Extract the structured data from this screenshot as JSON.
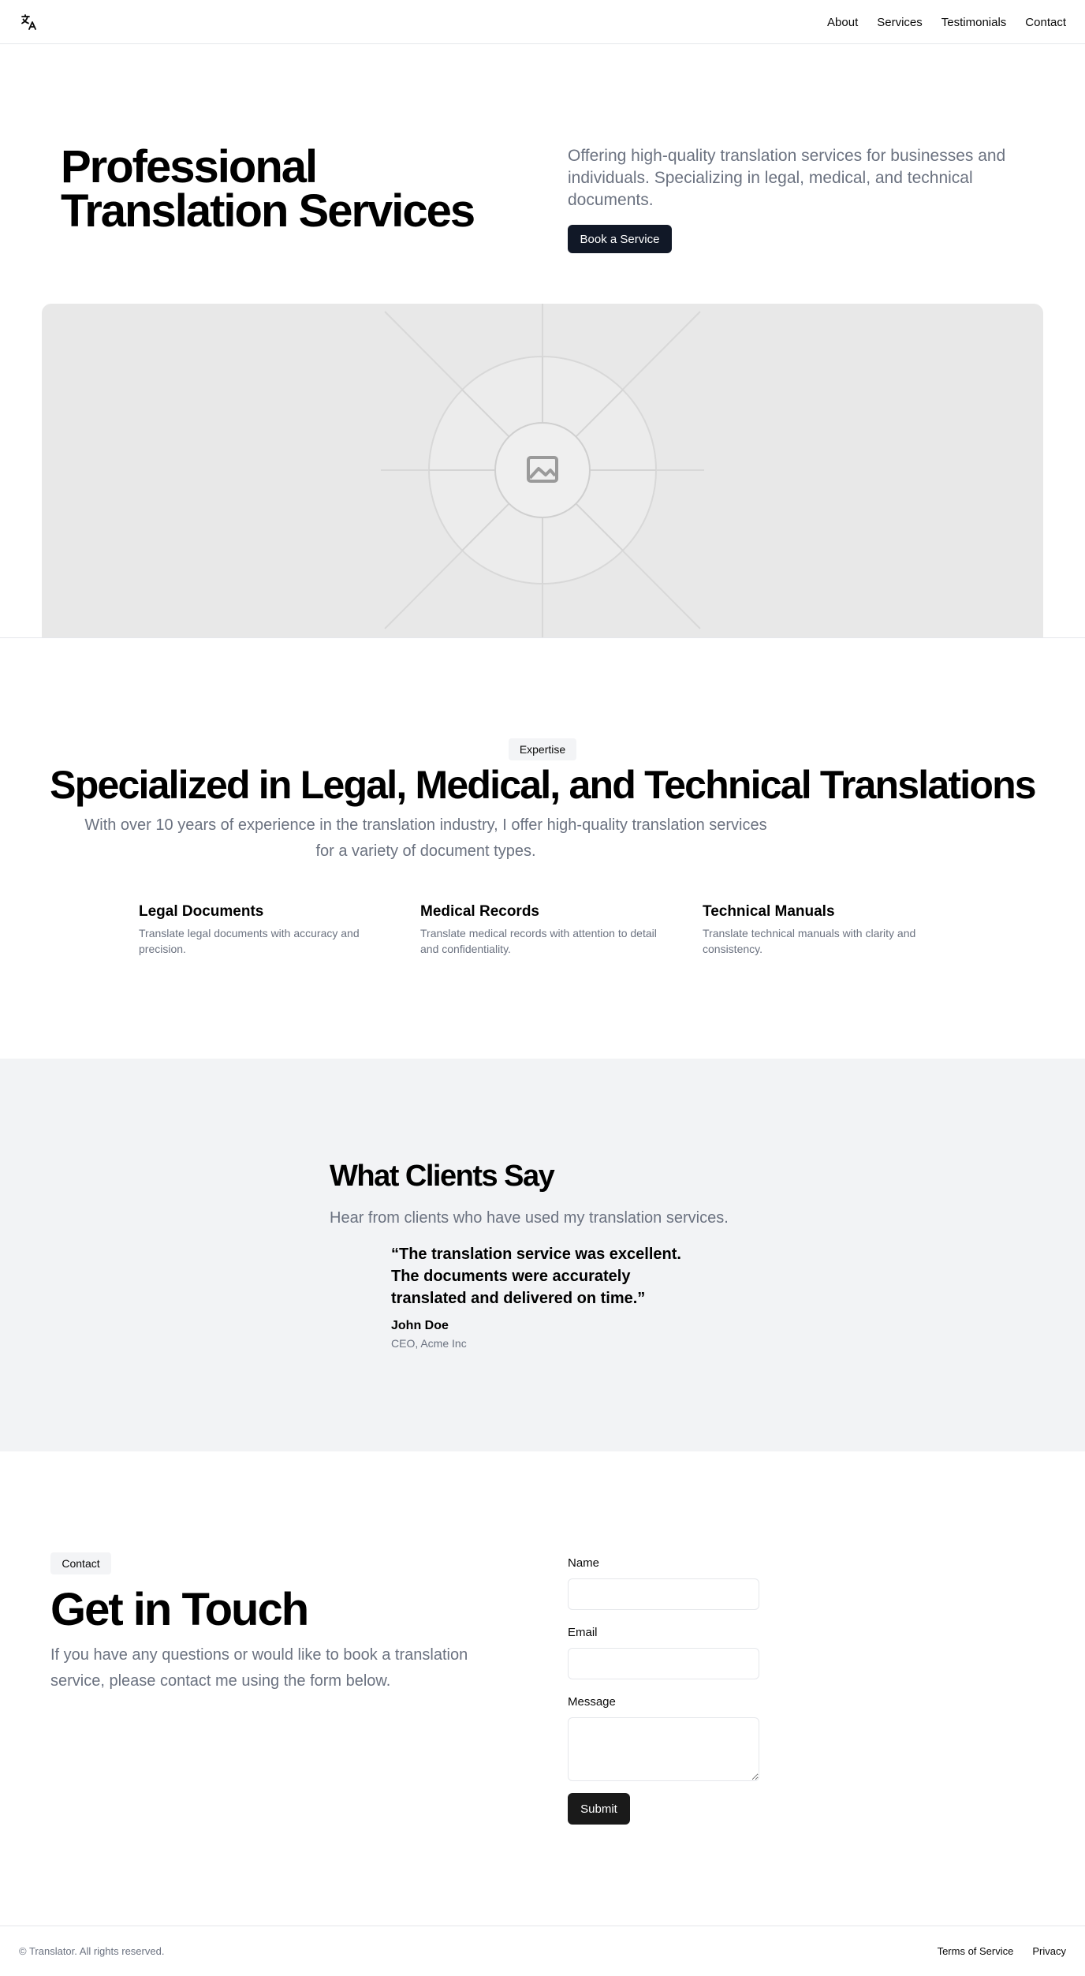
{
  "nav": {
    "logo_icon": "translate-icon",
    "links": [
      "About",
      "Services",
      "Testimonials",
      "Contact"
    ]
  },
  "hero": {
    "title": "Professional Translation Services",
    "description": "Offering high-quality translation services for businesses and individuals. Specializing in legal, medical, and technical documents.",
    "button": "Book a Service",
    "image_icon": "image-placeholder-icon"
  },
  "expertise": {
    "badge": "Expertise",
    "title": "Specialized in Legal, Medical, and Technical Translations",
    "description": "With over 10 years of experience in the translation industry, I offer high-quality translation services for a variety of document types.",
    "features": [
      {
        "title": "Legal Documents",
        "text": "Translate legal documents with accuracy and precision."
      },
      {
        "title": "Medical Records",
        "text": "Translate medical records with attention to detail and confidentiality."
      },
      {
        "title": "Technical Manuals",
        "text": "Translate technical manuals with clarity and consistency."
      }
    ]
  },
  "testimonials": {
    "title": "What Clients Say",
    "subtitle": "Hear from clients who have used my translation services.",
    "quote": "“The translation service was excellent. The documents were accurately translated and delivered on time.”",
    "author": "John Doe",
    "role": "CEO, Acme Inc"
  },
  "contact": {
    "badge": "Contact",
    "title": "Get in Touch",
    "description": "If you have any questions or would like to book a translation service, please contact me using the form below.",
    "name_label": "Name",
    "name_value": "",
    "email_label": "Email",
    "email_value": "",
    "message_label": "Message",
    "message_value": "",
    "submit": "Submit"
  },
  "footer": {
    "copyright": "© Translator. All rights reserved.",
    "links": [
      "Terms of Service",
      "Privacy"
    ]
  },
  "colors": {
    "primary_button": "#111827",
    "muted_text": "#6b7280",
    "testimonial_bg": "#f2f3f5"
  }
}
